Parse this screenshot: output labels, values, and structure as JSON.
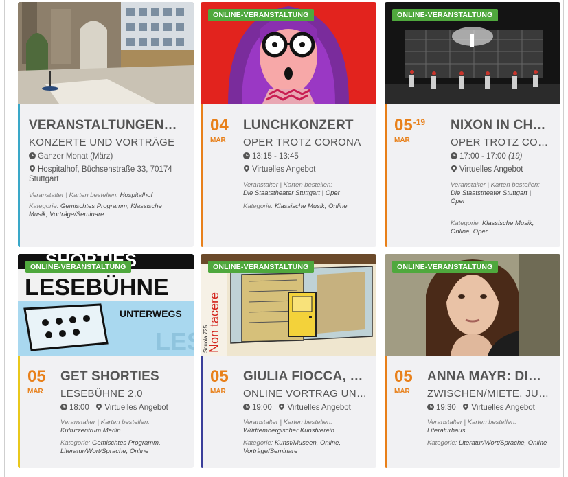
{
  "badge_label": "ONLINE-VERANSTALTUNG",
  "organizer_label": "Veranstalter | Karten bestellen:",
  "category_label": "Kategorie:",
  "cards": [
    {
      "title": "VERANSTALTUNGEN…",
      "subtitle": "KONZERTE UND VORTRÄGE",
      "time": "Ganzer Monat (März)",
      "location": "Hospitalhof, Büchsenstraße 33, 70174 Stuttgart",
      "organizer": "Hospitalhof",
      "categories": "Gemischtes Programm, Klassische Musik, Vorträge/Seminare",
      "accent": "#3aa8c8"
    },
    {
      "day": "04",
      "month": "MAR",
      "title": "LUNCHKONZERT",
      "subtitle": "OPER TROTZ CORONA",
      "time": "13:15 - 13:45",
      "location": "Virtuelles Angebot",
      "organizer": "Die Staatstheater Stuttgart | Oper",
      "categories": "Klassische Musik, Online",
      "accent": "#e8801a",
      "badge": true
    },
    {
      "day": "05",
      "day_end": "-19",
      "month": "MAR",
      "title": "NIXON IN CH…",
      "subtitle": "OPER TROTZ COR…",
      "time": "17:00 - 17:00",
      "time_extra": "(19)",
      "location": "Virtuelles Angebot",
      "organizer": "Die Staatstheater Stuttgart | Oper",
      "categories": "Klassische Musik, Online, Oper",
      "accent": "#e8801a",
      "badge": true
    },
    {
      "day": "05",
      "month": "MAR",
      "title": "GET SHORTIES",
      "subtitle": "LESEBÜHNE 2.0",
      "time": "18:00",
      "location": "Virtuelles Angebot",
      "organizer": "Kulturzentrum Merlin",
      "categories": "Gemischtes Programm, Literatur/Wort/Sprache, Online",
      "accent": "#e9c81c",
      "badge": true,
      "image_text": [
        "SHORTIES",
        "LESEBÜHNE",
        "UNTERWEGS"
      ]
    },
    {
      "day": "05",
      "month": "MAR",
      "title": "GIULIA FIOCCA, …",
      "subtitle": "ONLINE VORTRAG UN…",
      "time": "19:00",
      "location": "Virtuelles Angebot",
      "organizer": "Württembergischer Kunstverein",
      "categories": "Kunst/Museen, Online, Vorträge/Seminare",
      "accent": "#3b3f9a",
      "badge": true,
      "image_text": [
        "Non tacere",
        "Scuola 725"
      ]
    },
    {
      "day": "05",
      "month": "MAR",
      "title": "ANNA MAYR: DI…",
      "subtitle": "ZWISCHEN/MIETE. JUN…",
      "time": "19:30",
      "location": "Virtuelles Angebot",
      "organizer": "Literaturhaus",
      "categories": "Literatur/Wort/Sprache, Online",
      "accent": "#e8801a",
      "badge": true
    }
  ]
}
